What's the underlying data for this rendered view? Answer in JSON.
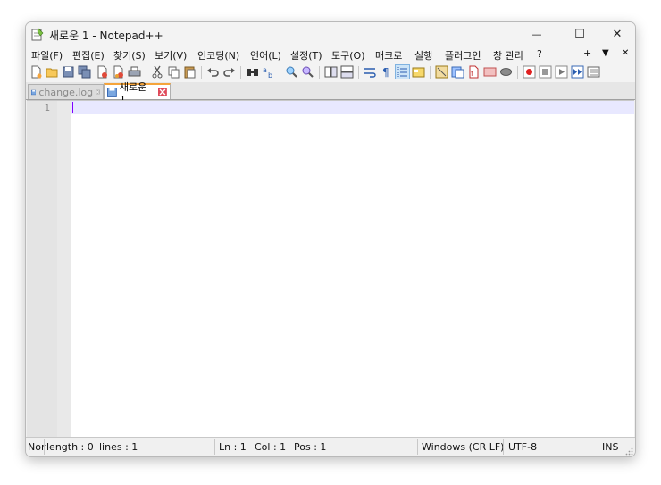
{
  "window": {
    "title": "새로운 1 - Notepad++",
    "minimize_glyph": "—",
    "maximize_glyph": "☐",
    "close_glyph": "✕"
  },
  "menu": {
    "items": [
      "파일(F)",
      "편집(E)",
      "찾기(S)",
      "보기(V)",
      "인코딩(N)",
      "언어(L)",
      "설정(T)",
      "도구(O)",
      "매크로",
      "실행",
      "플러그인",
      "창 관리",
      "?"
    ],
    "right_plus": "+",
    "right_down": "▼",
    "right_close": "✕"
  },
  "toolbar": {
    "icons": [
      "new-file-icon",
      "open-file-icon",
      "save-icon",
      "save-all-icon",
      "close-icon",
      "close-all-icon",
      "print-icon",
      "cut-icon",
      "copy-icon",
      "paste-icon",
      "undo-icon",
      "redo-icon",
      "find-icon",
      "replace-icon",
      "zoom-in-icon",
      "zoom-out-icon",
      "sync-vertical-icon",
      "sync-horizontal-icon",
      "word-wrap-icon",
      "show-all-chars-icon",
      "indent-guide-icon",
      "language-icon",
      "doc-map-icon",
      "function-list-icon",
      "folder-workspace-icon",
      "monitoring-icon",
      "record-macro-icon",
      "stop-record-icon",
      "play-macro-icon",
      "run-macro-multiple-icon",
      "save-macro-icon"
    ]
  },
  "tabs": [
    {
      "label": "change.log",
      "active": false
    },
    {
      "label": "새로운 1",
      "active": true
    }
  ],
  "editor": {
    "line_numbers": [
      "1"
    ]
  },
  "status": {
    "doc_type": "Nor",
    "length": "length : 0",
    "lines": "lines : 1",
    "ln": "Ln : 1",
    "col": "Col : 1",
    "pos": "Pos : 1",
    "eol": "Windows (CR LF)",
    "encoding": "UTF-8",
    "mode": "INS"
  },
  "colors": {
    "tab_accent": "#f5a43b",
    "current_line": "#e8e8ff",
    "caret": "#8000ff"
  }
}
